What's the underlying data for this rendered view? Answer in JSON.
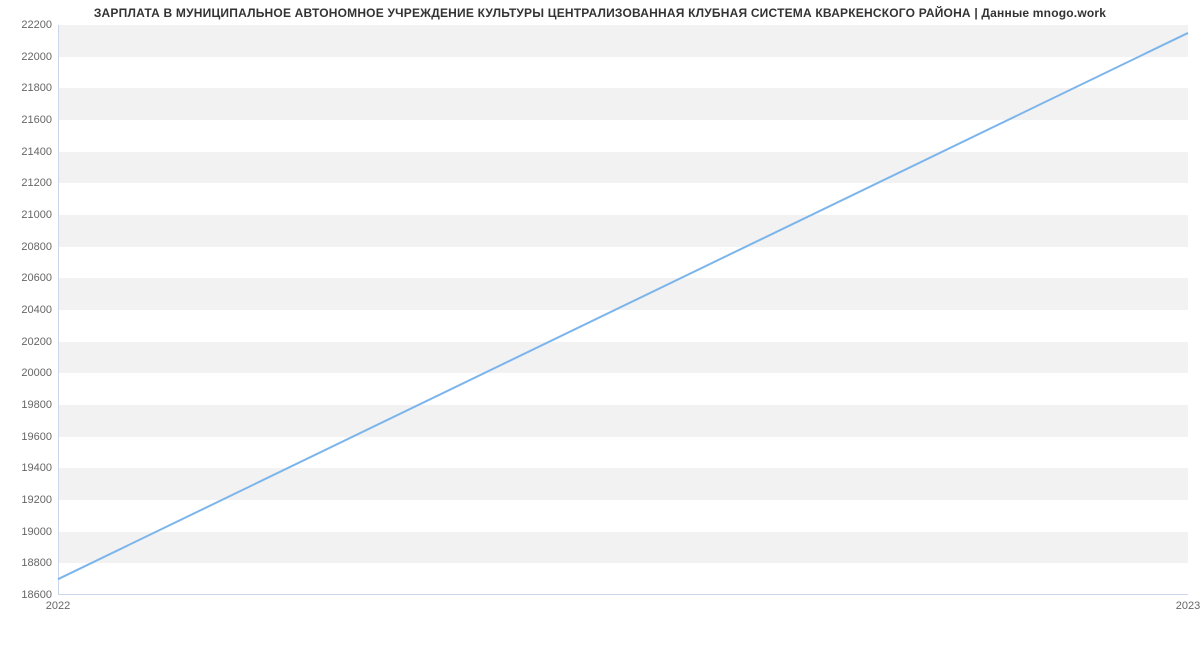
{
  "chart_data": {
    "type": "line",
    "title": "ЗАРПЛАТА В МУНИЦИПАЛЬНОЕ АВТОНОМНОЕ УЧРЕЖДЕНИЕ КУЛЬТУРЫ ЦЕНТРАЛИЗОВАННАЯ КЛУБНАЯ СИСТЕМА КВАРКЕНСКОГО РАЙОНА | Данные mnogo.work",
    "x": [
      "2022",
      "2023"
    ],
    "values": [
      18700,
      22150
    ],
    "xlabel": "",
    "ylabel": "",
    "ylim": [
      18600,
      22200
    ],
    "y_ticks": [
      18600,
      18800,
      19000,
      19200,
      19400,
      19600,
      19800,
      20000,
      20200,
      20400,
      20600,
      20800,
      21000,
      21200,
      21400,
      21600,
      21800,
      22000,
      22200
    ],
    "x_ticks": [
      "2022",
      "2023"
    ],
    "line_color": "#7cb5ec"
  }
}
